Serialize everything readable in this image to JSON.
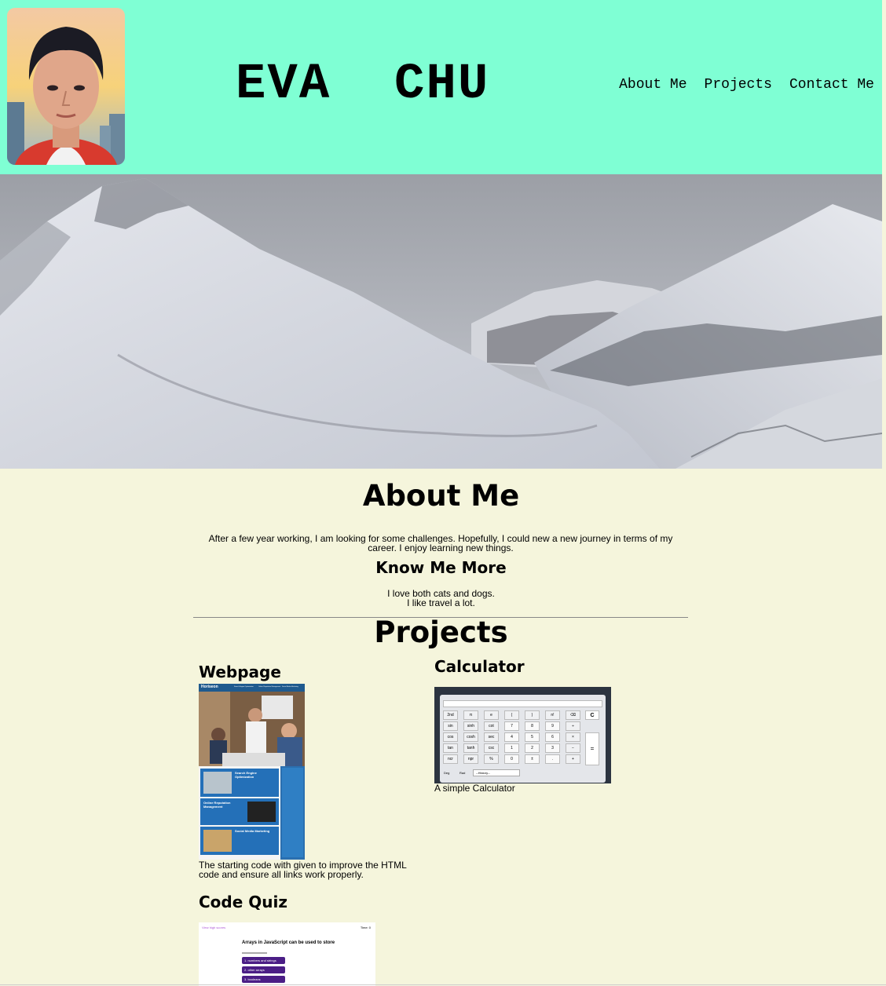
{
  "header": {
    "name": "EVA  CHU",
    "nav": [
      "About Me",
      "Projects",
      "Contact Me"
    ]
  },
  "about": {
    "title": "About Me",
    "text": "After a few year working, I am looking for some challenges. Hopefully, I could new a new journey in terms of my career. I enjoy learning new things.",
    "know_title": "Know Me More",
    "know_lines": [
      "I love both cats and dogs.",
      "I like travel a lot."
    ]
  },
  "projects": {
    "title": "Projects",
    "items": [
      {
        "title": "Webpage",
        "description": "The starting code with given to improve the HTML code and ensure all links work properly.",
        "thumb": {
          "brand": "Horiseon",
          "nav": [
            "Search Engine Optimization",
            "Online Reputation Management",
            "Social Media Marketing"
          ],
          "sections": [
            "Search Engine Optimization",
            "Online Reputation Management",
            "Social Media Marketing"
          ]
        }
      },
      {
        "title": "Calculator",
        "description": "A simple Calculator",
        "thumb": {
          "history": "--History--",
          "keys": [
            [
              "2nd",
              "π",
              "e",
              "(",
              ")",
              "n!",
              "⌫"
            ],
            [
              "sin",
              "sinh",
              "cot",
              "7",
              "8",
              "9",
              "÷"
            ],
            [
              "cos",
              "cosh",
              "sec",
              "4",
              "5",
              "6",
              "×"
            ],
            [
              "tan",
              "tanh",
              "csc",
              "1",
              "2",
              "3",
              "−"
            ],
            [
              "ncr",
              "npr",
              "%",
              "0",
              "±",
              ".",
              "+"
            ]
          ],
          "clear_key": "C",
          "equals_key": "=",
          "mode": [
            "Deg",
            "Rad"
          ]
        }
      },
      {
        "title": "Code Quiz",
        "thumb": {
          "highscores": "View high scores",
          "time": "Time: 0",
          "question": "Arrays in JavaScript can be used to store",
          "answers": [
            "1. numbers and strings",
            "2. other arrays",
            "3. booleans"
          ]
        }
      }
    ]
  },
  "colors": {
    "header_bg": "#7fffd4",
    "page_bg": "#f5f5dc",
    "quiz_accent": "#4b1e86"
  }
}
